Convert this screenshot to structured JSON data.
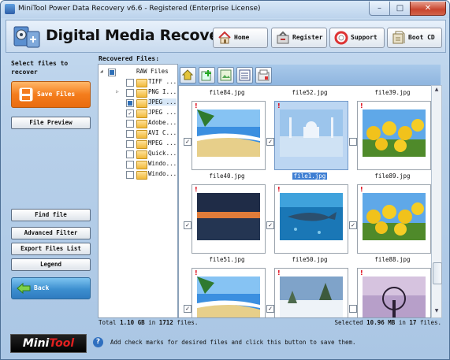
{
  "window": {
    "title": "MiniTool Power Data Recovery v6.6 - Registered (Enterprise License)",
    "minimize": "–",
    "maximize": "□",
    "close": "✕"
  },
  "header": {
    "heading": "Digital Media Recovery",
    "buttons": [
      {
        "label": "Home",
        "icon": "home-icon"
      },
      {
        "label": "Register",
        "icon": "register-icon"
      },
      {
        "label": "Support",
        "icon": "support-icon"
      },
      {
        "label": "Boot CD",
        "icon": "boot-cd-icon"
      }
    ]
  },
  "sidebar": {
    "title": "Select files to recover",
    "save_label": "Save Files",
    "preview_label": "File Preview",
    "find_label": "Find file",
    "advanced_label": "Advanced Filter",
    "export_label": "Export Files List",
    "legend_label": "Legend",
    "back_label": "Back"
  },
  "recovered_label": "Recovered Files:",
  "tree": [
    {
      "label": "RAW Files",
      "check": "partial",
      "arrow": "◢"
    },
    {
      "label": "TIFF ...",
      "check": "",
      "arrow": ""
    },
    {
      "label": "PNG I...",
      "check": "",
      "arrow": "▷"
    },
    {
      "label": "JPEG ...",
      "check": "partial",
      "arrow": "",
      "selected": true
    },
    {
      "label": "JPEG ...",
      "check": "✓",
      "arrow": ""
    },
    {
      "label": "Adobe...",
      "check": "",
      "arrow": ""
    },
    {
      "label": "AVI C...",
      "check": "",
      "arrow": ""
    },
    {
      "label": "MPEG ...",
      "check": "",
      "arrow": ""
    },
    {
      "label": "Quick...",
      "check": "",
      "arrow": ""
    },
    {
      "label": "Windo...",
      "check": "",
      "arrow": ""
    },
    {
      "label": "Windo...",
      "check": "",
      "arrow": ""
    }
  ],
  "grid": {
    "top_names": [
      "file84.jpg",
      "file52.jpg",
      "file39.jpg"
    ],
    "rows": [
      [
        {
          "name": "file40.jpg",
          "checked": "✓",
          "thumb": "beach",
          "selected": false
        },
        {
          "name": "file1.jpg",
          "checked": "✓",
          "thumb": "mosque",
          "selected": true
        },
        {
          "name": "file89.jpg",
          "checked": "",
          "thumb": "tulips",
          "selected": false
        }
      ],
      [
        {
          "name": "file51.jpg",
          "checked": "✓",
          "thumb": "dusk",
          "selected": false
        },
        {
          "name": "file50.jpg",
          "checked": "✓",
          "thumb": "whale",
          "selected": false
        },
        {
          "name": "file88.jpg",
          "checked": "✓",
          "thumb": "tulips",
          "selected": false
        }
      ],
      [
        {
          "name": "",
          "checked": "✓",
          "thumb": "beach",
          "selected": false
        },
        {
          "name": "",
          "checked": "✓",
          "thumb": "snow",
          "selected": false
        },
        {
          "name": "",
          "checked": "",
          "thumb": "tree",
          "selected": false
        }
      ]
    ]
  },
  "status": {
    "total_prefix": "Total",
    "total_size": "1.10 GB",
    "total_mid": "in",
    "total_count": "1712",
    "total_suffix": "files.",
    "selected_prefix": "Selected",
    "selected_size": "10.96 MB",
    "selected_mid": "in",
    "selected_count": "17",
    "selected_suffix": "files."
  },
  "footer": {
    "brand_mini": "Mini",
    "brand_tool": "Tool",
    "help_glyph": "?",
    "help_text": "Add check marks for desired files and click this button to save them."
  }
}
